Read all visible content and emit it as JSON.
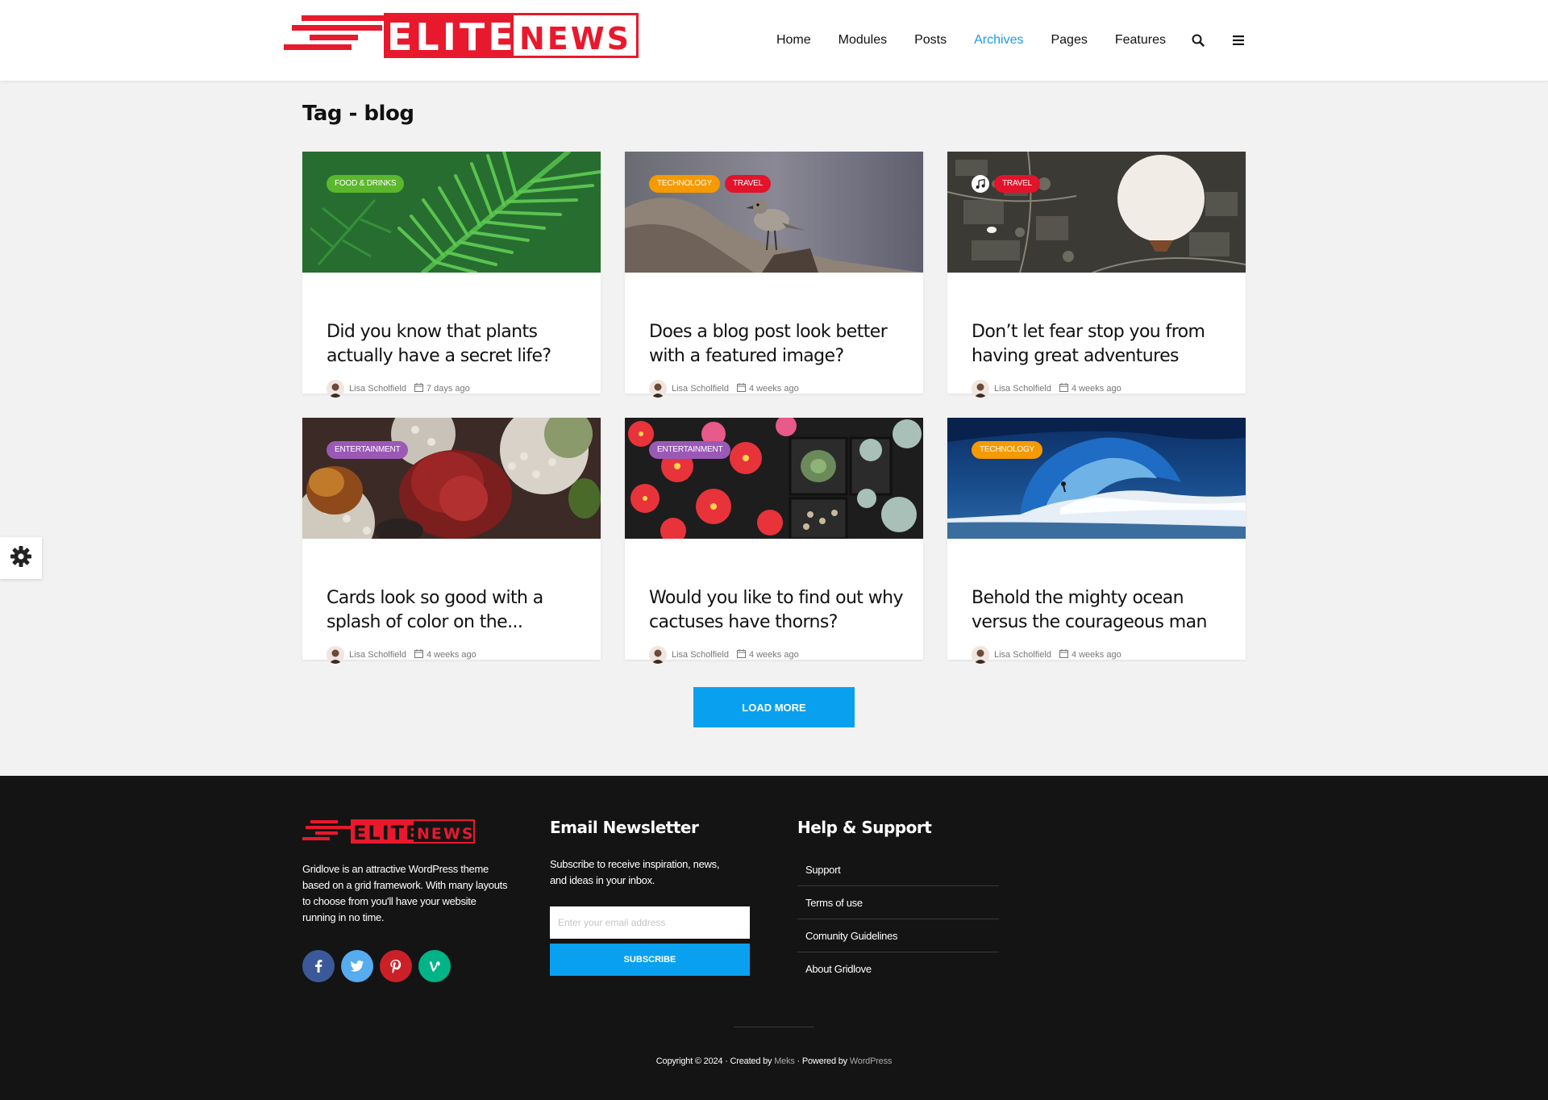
{
  "header": {
    "logo": {
      "text_left": "ELITE",
      "text_right": "NEWS",
      "brand_color": "#e8192c"
    },
    "nav": [
      {
        "label": "Home",
        "active": false
      },
      {
        "label": "Modules",
        "active": false
      },
      {
        "label": "Posts",
        "active": false
      },
      {
        "label": "Archives",
        "active": true
      },
      {
        "label": "Pages",
        "active": false
      },
      {
        "label": "Features",
        "active": false
      }
    ],
    "icons": [
      "search-icon",
      "menu-icon"
    ],
    "active_color": "#1e9be8"
  },
  "page": {
    "title": "Tag - blog"
  },
  "posts": [
    {
      "title": "Did you know that plants actually have a secret life?",
      "badges": [
        {
          "label": "FOOD & DRINKS",
          "color": "#5bb72c"
        }
      ],
      "author": "Lisa Scholfield",
      "date": "7 days ago",
      "image": "fern-leaves"
    },
    {
      "title": "Does a blog post look better with a featured image?",
      "badges": [
        {
          "label": "TECHNOLOGY",
          "color": "#f59a00"
        },
        {
          "label": "TRAVEL",
          "color": "#e2132b"
        }
      ],
      "author": "Lisa Scholfield",
      "date": "4 weeks ago",
      "image": "bird-on-branch"
    },
    {
      "title": "Don’t let fear stop you from having great adventures",
      "badges": [
        {
          "label": "TRAVEL",
          "color": "#e2132b"
        }
      ],
      "audio": true,
      "author": "Lisa Scholfield",
      "date": "4 weeks ago",
      "image": "hot-air-balloon"
    },
    {
      "title": "Cards look so good with a splash of color on the...",
      "badges": [
        {
          "label": "ENTERTAINMENT",
          "color": "#9b59b6"
        }
      ],
      "author": "Lisa Scholfield",
      "date": "4 weeks ago",
      "image": "potted-plants"
    },
    {
      "title": "Would you like to find out why cactuses have thorns?",
      "badges": [
        {
          "label": "ENTERTAINMENT",
          "color": "#9b59b6"
        }
      ],
      "author": "Lisa Scholfield",
      "date": "4 weeks ago",
      "image": "cactus-tray"
    },
    {
      "title": "Behold the mighty ocean versus the courageous man",
      "badges": [
        {
          "label": "TECHNOLOGY",
          "color": "#f59a00"
        }
      ],
      "author": "Lisa Scholfield",
      "date": "4 weeks ago",
      "image": "ocean-wave-surfer"
    }
  ],
  "load_more": {
    "label": "LOAD MORE",
    "color": "#0aa0f0"
  },
  "footer": {
    "about": "Gridlove is an attractive WordPress theme based on a grid framework. With many layouts to choose from you'll have your website running in no time.",
    "socials": [
      {
        "name": "facebook-icon",
        "color": "#3b5998"
      },
      {
        "name": "twitter-icon",
        "color": "#55acee"
      },
      {
        "name": "pinterest-icon",
        "color": "#cb2027"
      },
      {
        "name": "vine-icon",
        "color": "#00b488"
      }
    ],
    "newsletter": {
      "heading": "Email Newsletter",
      "text": "Subscribe to receive inspiration, news, and ideas in your inbox.",
      "placeholder": "Enter your email address",
      "button": "SUBSCRIBE"
    },
    "support": {
      "heading": "Help & Support",
      "links": [
        "Support",
        "Terms of use",
        "Comunity Guidelines",
        "About Gridlove"
      ]
    },
    "copyright": {
      "prefix": "Copyright © 2024 · Created by ",
      "author_link": "Meks",
      "middle": " · Powered by ",
      "platform_link": "WordPress"
    }
  },
  "settings": {
    "icon": "gear-icon"
  }
}
